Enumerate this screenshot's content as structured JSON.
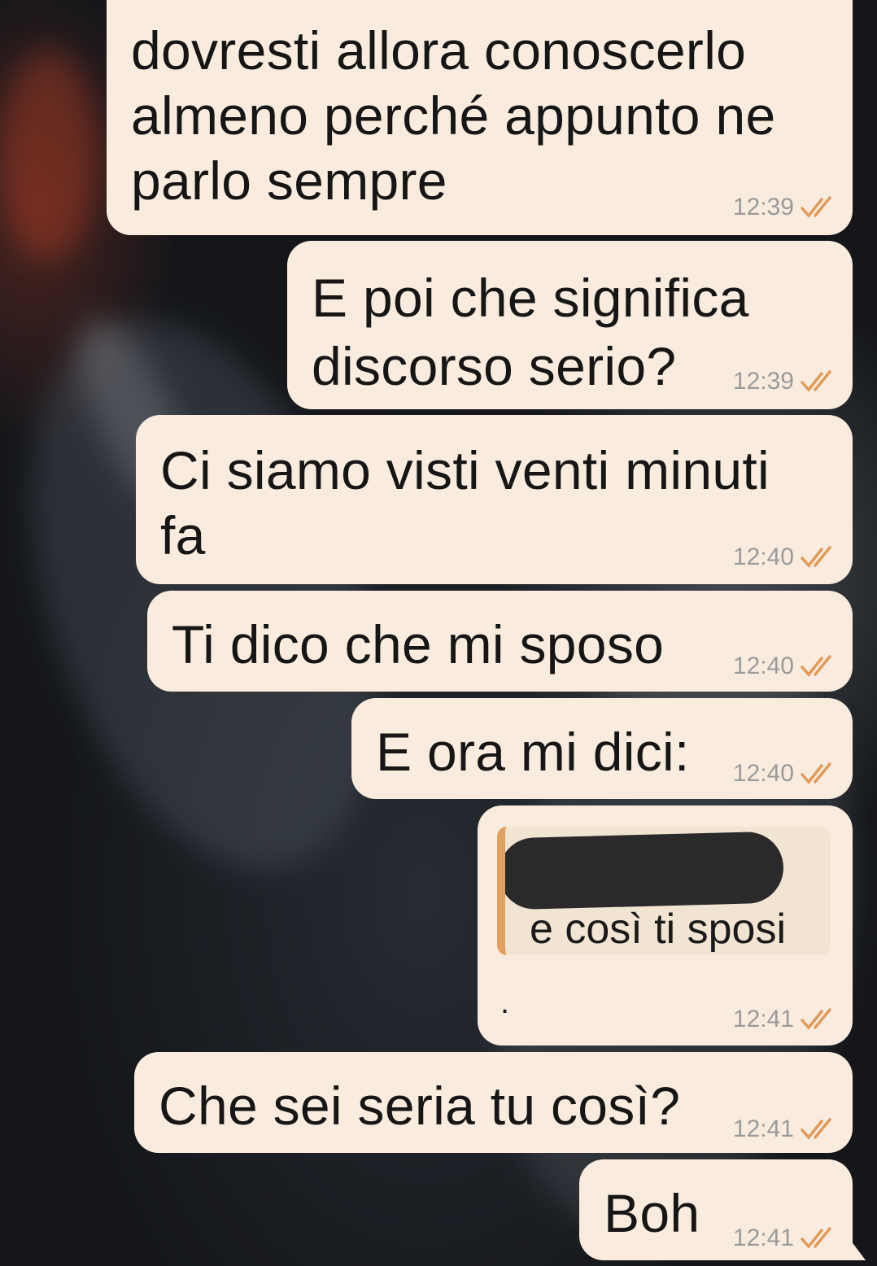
{
  "messages": [
    {
      "text": "dovresti allora conoscerlo\nalmeno perché appunto ne\nparlo sempre",
      "time": "12:39"
    },
    {
      "text": "E poi che significa\ndiscorso serio?",
      "time": "12:39"
    },
    {
      "text": "Ci siamo visti venti minuti\nfa",
      "time": "12:40"
    },
    {
      "text": "Ti dico che mi sposo",
      "time": "12:40"
    },
    {
      "text": "E ora mi dici:",
      "time": "12:40"
    },
    {
      "quote_text": "e così ti sposi",
      "text": ".",
      "time": "12:41"
    },
    {
      "text": "Che sei seria tu così?",
      "time": "12:41"
    },
    {
      "text": "Boh",
      "time": "12:41"
    }
  ],
  "colors": {
    "bubble": "#f9ecdf",
    "quote_bar": "#e0a060",
    "tick": "#e09a5a",
    "time": "#9a9a9a"
  },
  "icons": {
    "read_receipt": "double-check-icon"
  }
}
